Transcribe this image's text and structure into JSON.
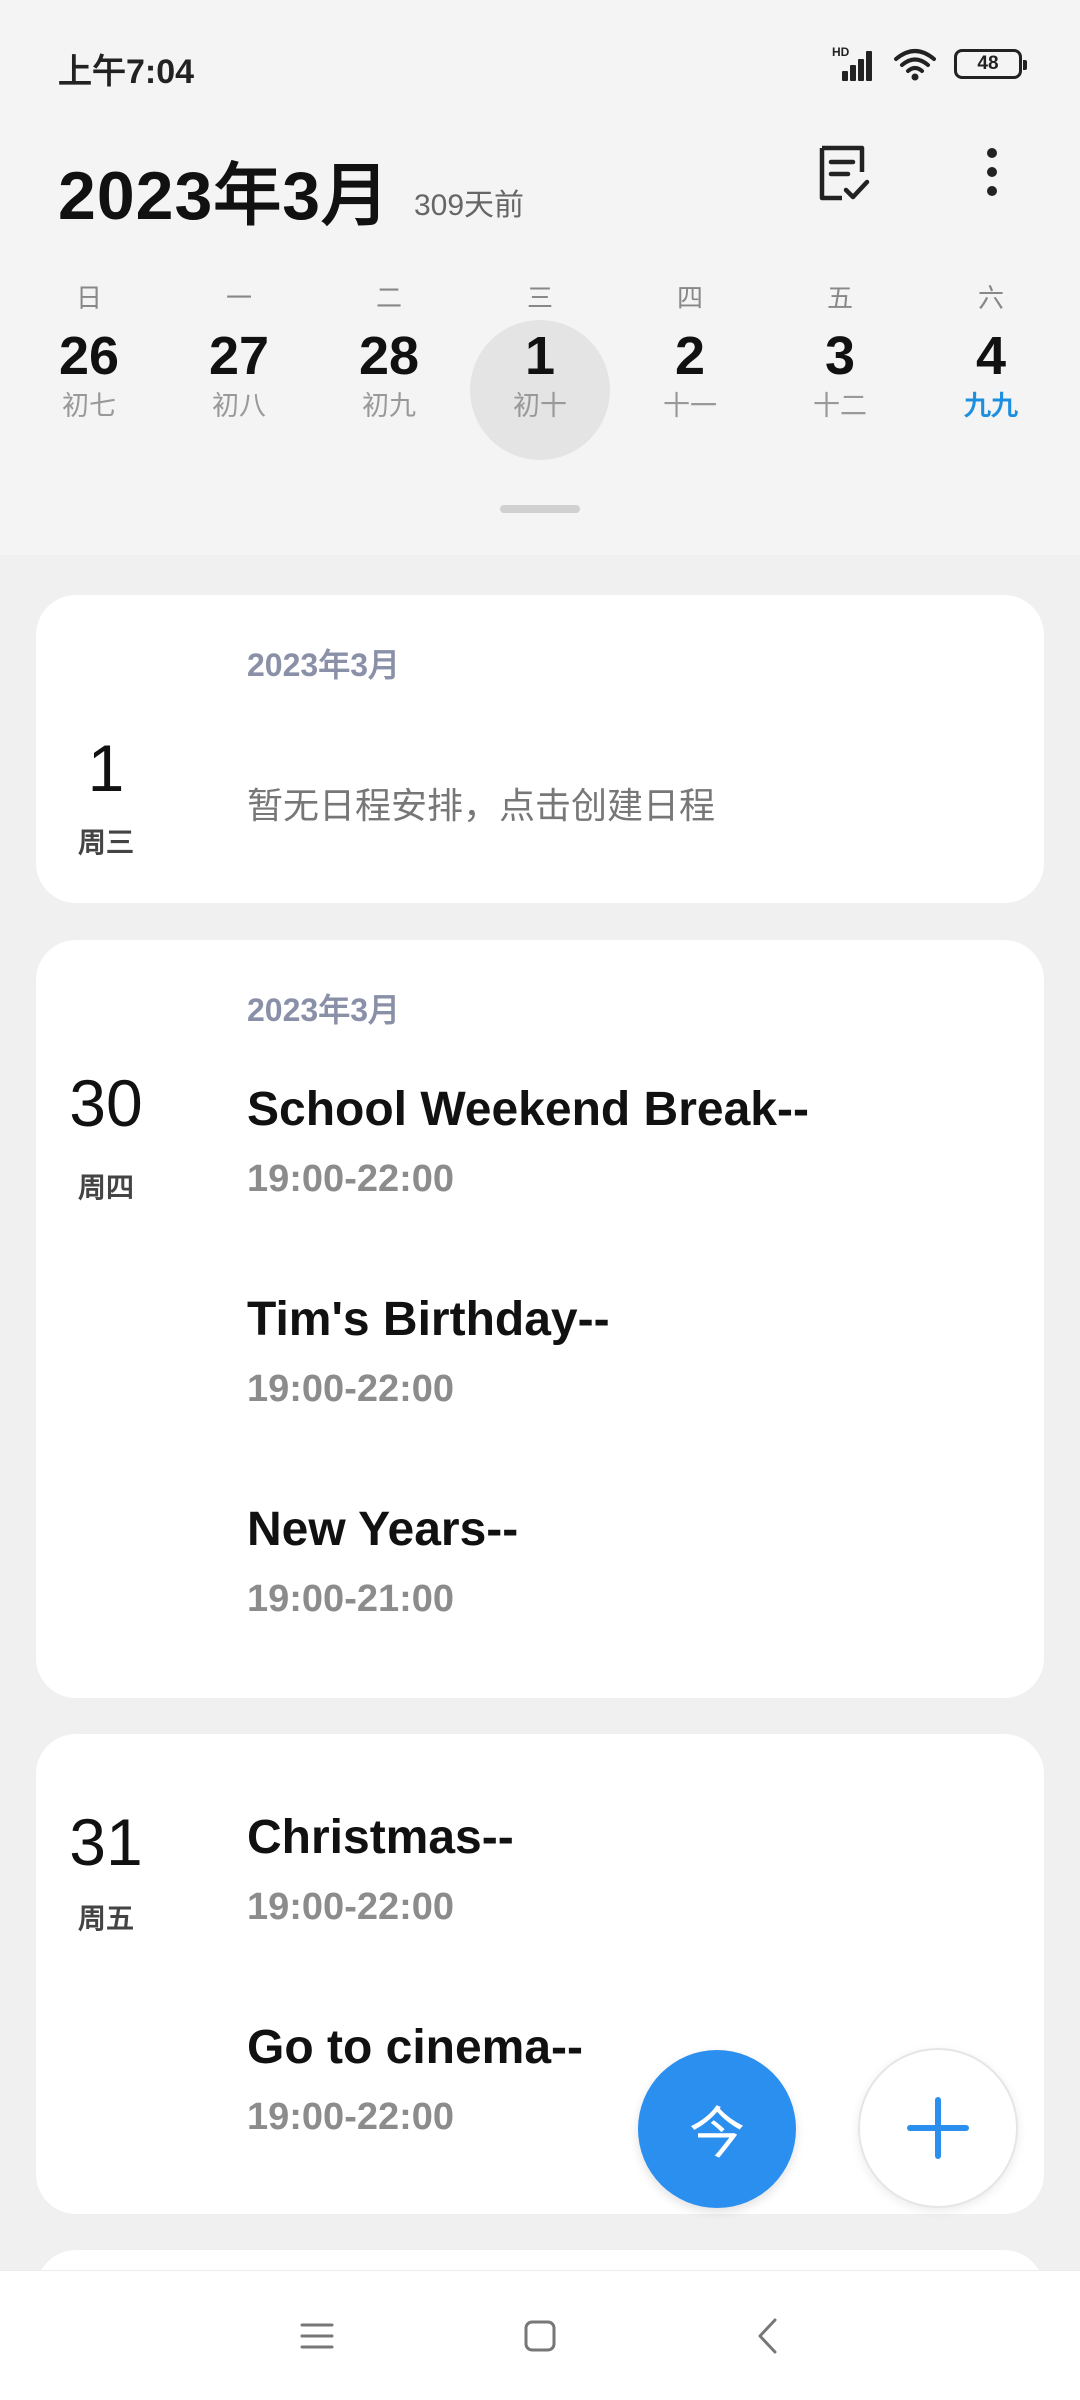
{
  "status_bar": {
    "time": "上午7:04",
    "signal_label": "HD",
    "battery_level": "48"
  },
  "header": {
    "title": "2023年3月",
    "subtitle": "309天前"
  },
  "week": [
    {
      "weekday": "日",
      "day": "26",
      "lunar": "初七"
    },
    {
      "weekday": "一",
      "day": "27",
      "lunar": "初八"
    },
    {
      "weekday": "二",
      "day": "28",
      "lunar": "初九"
    },
    {
      "weekday": "三",
      "day": "1",
      "lunar": "初十",
      "selected": true
    },
    {
      "weekday": "四",
      "day": "2",
      "lunar": "十一"
    },
    {
      "weekday": "五",
      "day": "3",
      "lunar": "十二"
    },
    {
      "weekday": "六",
      "day": "4",
      "lunar": "九九",
      "festival": true
    }
  ],
  "cards": [
    {
      "month": "2023年3月",
      "day": "1",
      "weekday": "周三",
      "empty_text": "暂无日程安排，点击创建日程",
      "events": []
    },
    {
      "month": "2023年3月",
      "day": "30",
      "weekday": "周四",
      "events": [
        {
          "title": "School Weekend Break--",
          "time": "19:00-22:00"
        },
        {
          "title": "Tim's Birthday--",
          "time": "19:00-22:00"
        },
        {
          "title": "New Years--",
          "time": "19:00-21:00"
        }
      ]
    },
    {
      "day": "31",
      "weekday": "周五",
      "events": [
        {
          "title": "Christmas--",
          "time": "19:00-22:00"
        },
        {
          "title": "Go to cinema--",
          "time": "19:00-22:00"
        }
      ]
    }
  ],
  "fab": {
    "today_label": "今"
  },
  "colors": {
    "accent": "#2b8ff0",
    "festival": "#1e8fe0",
    "month_label": "#8a90a8"
  },
  "icons": [
    "hd-signal-icon",
    "wifi-icon",
    "battery-icon",
    "agenda-list-icon",
    "more-vert-icon",
    "plus-icon",
    "menu-icon",
    "home-icon",
    "back-icon"
  ]
}
